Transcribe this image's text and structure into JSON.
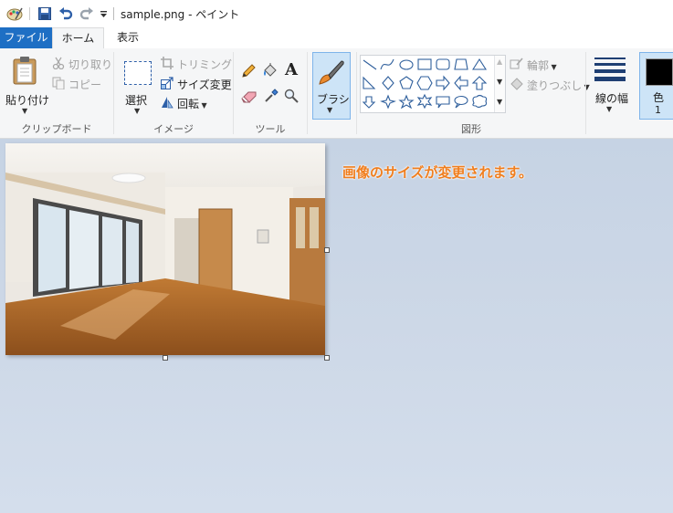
{
  "window": {
    "title": "sample.png - ペイント"
  },
  "tabs": {
    "file": "ファイル",
    "home": "ホーム",
    "view": "表示"
  },
  "clipboard": {
    "paste": "貼り付け",
    "cut": "切り取り",
    "copy": "コピー",
    "group": "クリップボード"
  },
  "image": {
    "select": "選択",
    "crop": "トリミング",
    "resize": "サイズ変更",
    "rotate": "回転",
    "group": "イメージ"
  },
  "tools": {
    "group": "ツール"
  },
  "brush": {
    "label": "ブラシ"
  },
  "shapes": {
    "group": "図形",
    "outline": "輪郭",
    "fill": "塗りつぶし"
  },
  "size": {
    "label": "線の幅"
  },
  "color": {
    "label": "色",
    "number": "1",
    "value": "#000000"
  },
  "canvas": {
    "notice": "画像のサイズが変更されます。",
    "accent": "#f07e1e",
    "background": "#c9d5e6"
  },
  "accent": {
    "file_tab": "#1e6fc4"
  },
  "icons": [
    "paint-app-icon",
    "save-icon",
    "undo-icon",
    "redo-icon",
    "customize-dropdown-icon",
    "paste-icon",
    "cut-icon",
    "copy-icon",
    "select-icon",
    "crop-icon",
    "resize-icon",
    "rotate-icon",
    "pencil-icon",
    "fill-bucket-icon",
    "text-icon",
    "eraser-icon",
    "color-picker-icon",
    "magnifier-icon",
    "brush-icon"
  ]
}
